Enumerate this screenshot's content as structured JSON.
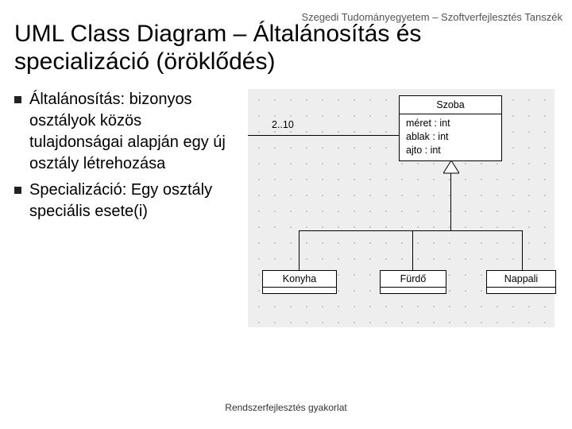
{
  "header": "Szegedi Tudományegyetem – Szoftverfejlesztés Tanszék",
  "title": "UML Class Diagram – Általánosítás és specializáció (öröklődés)",
  "bullets": [
    "Általánosítás: bizonyos osztályok közös tulajdonságai alapján egy új osztály létrehozása",
    "Specializáció: Egy osztály speciális esete(i)"
  ],
  "uml": {
    "superclass": {
      "name": "Szoba",
      "attrs": [
        "méret : int",
        "ablak : int",
        "ajto : int"
      ]
    },
    "subclasses": [
      "Konyha",
      "Fürdő",
      "Nappali"
    ],
    "multiplicity": "2..10"
  },
  "footer": "Rendszerfejlesztés gyakorlat"
}
